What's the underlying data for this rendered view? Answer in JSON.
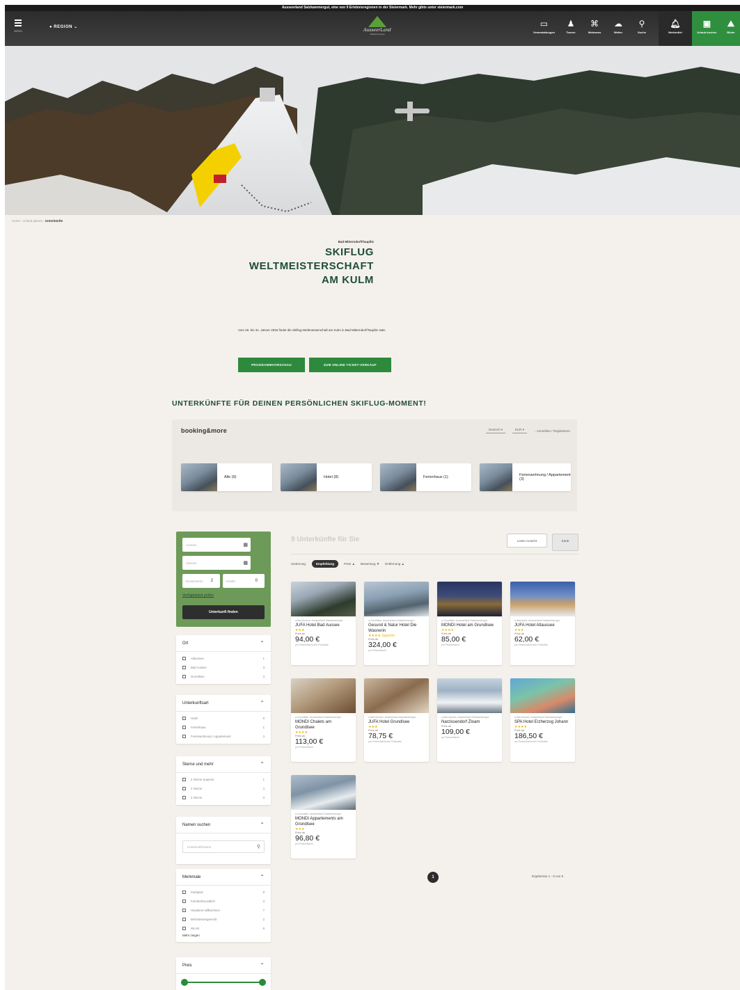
{
  "top_strip": {
    "text": "Ausseerland Salzkammergut, eine von 9 Erlebnisregionen in der Steiermark. Mehr gibts unter steiermark.com"
  },
  "nav": {
    "menu_label": "MENÜ",
    "region_label": "REGION",
    "logo_title": "AusseerLand",
    "logo_sub": "Salzkammergut",
    "items": [
      {
        "label": "Veranstaltungen",
        "icon": "calendar-icon",
        "glyph": "▭"
      },
      {
        "label": "Touren",
        "icon": "hiker-icon",
        "glyph": "♟"
      },
      {
        "label": "Webcams",
        "icon": "webcam-icon",
        "glyph": "⌘"
      },
      {
        "label": "Wetter",
        "icon": "weather-icon",
        "glyph": "☁"
      },
      {
        "label": "Suche",
        "icon": "search-icon",
        "glyph": "⚲"
      }
    ],
    "merkzettel": "Merkzettel",
    "urlaub_buchen": "Urlaub buchen",
    "bilder": "Bilder"
  },
  "breadcrumb": {
    "items": [
      "Home",
      "Urlaub planen"
    ],
    "current": "Unterkünfte"
  },
  "intro": {
    "kicker": "Bad Mitterndorf/Tauplitz",
    "title_lines": [
      "SKIFLUG",
      "WELTMEISTERSCHAFT",
      "AM KULM"
    ],
    "description": "Vom 26. bis 31. Jänner 2026 findet die Skiflug-Weltmeisterschaft am Kulm in Bad Mitterndorf/Tauplitz statt.",
    "btn_program": "PROGRAMMVORSCHAU",
    "btn_tickets": "ZUM ONLINE TICKET-VERKAUF"
  },
  "section_heading": "UNTERKÜNFTE FÜR DEINEN PERSÖNLICHEN SKIFLUG-MOMENT!",
  "booking_widget": {
    "brand": "booking&more",
    "language": "Deutsch",
    "currency": "EUR",
    "login": "Anmelden / Registrieren",
    "category_tabs": [
      {
        "label": "Alle (9)"
      },
      {
        "label": "Hotel (8)"
      },
      {
        "label": "Ferienhaus (1)"
      },
      {
        "label": "Ferienwohnung / Appartement (3)"
      }
    ]
  },
  "search_box": {
    "arrival_placeholder": "Anreise",
    "departure_placeholder": "Abreise",
    "adults_label": "Erwachsene",
    "adults_value": "2",
    "children_label": "Kinder",
    "children_value": "0",
    "availability_link": "Verfügbarkeit prüfen",
    "search_button": "Unterkunft finden"
  },
  "filters": {
    "ort": {
      "title": "Ort",
      "options": [
        {
          "label": "Altaussee",
          "count": "1"
        },
        {
          "label": "Bad Aussee",
          "count": "3"
        },
        {
          "label": "Grundlsee",
          "count": "3"
        }
      ]
    },
    "type": {
      "title": "Unterkunftsart",
      "options": [
        {
          "label": "Hotel",
          "count": "8"
        },
        {
          "label": "Ferienhaus",
          "count": "1"
        },
        {
          "label": "Ferienwohnung / Appartement",
          "count": "3"
        }
      ]
    },
    "stars": {
      "title": "Sterne und mehr",
      "options": [
        {
          "label": "4 Sterne Superior",
          "count": "1"
        },
        {
          "label": "4 Sterne",
          "count": "4"
        },
        {
          "label": "3 Sterne",
          "count": "3"
        }
      ]
    },
    "name": {
      "title": "Namen suchen",
      "placeholder": "Unterkunftsname"
    },
    "features": {
      "title": "Merkmale",
      "options": [
        {
          "label": "Parkplatz",
          "count": "8"
        },
        {
          "label": "Familienfreundlich",
          "count": "3"
        },
        {
          "label": "Haustiere willkommen",
          "count": "7"
        },
        {
          "label": "Behindertengerecht",
          "count": "2"
        },
        {
          "label": "WLAN",
          "count": "8"
        }
      ],
      "more": "Mehr zeigen"
    },
    "price": {
      "title": "Preis"
    }
  },
  "results": {
    "title": "9 Unterkünfte für Sie",
    "list_view": "Listen-Ansicht",
    "map_view": "Karte",
    "sort_label": "Sortierung:",
    "sort_options": [
      "Empfehlung",
      "Preis ▲",
      "Bewertung ▼",
      "Entfernung ▲"
    ],
    "cards": [
      {
        "loc": "Bad Aussee, Ausseerland Salzkammergut",
        "name": "JUFA Hotel Bad Aussee",
        "stars": "★★★",
        "price_label": "Preis ab",
        "price": "94,00 €",
        "price_sub": "pro Person/Nacht inkl. Frühstück"
      },
      {
        "loc": "Grundlsee, Ausseerland Salzkammergut",
        "name": "Gesund & Natur Hotel Die Wasnerin",
        "stars": "★★★★ Superior",
        "price_label": "Preis ab",
        "price": "324,00 €",
        "price_sub": "pro Person/Nacht"
      },
      {
        "loc": "Grundlsee, Ausseerland Salzkammergut",
        "name": "MONDI Hotel am Grundlsee",
        "stars": "★★★★",
        "price_label": "Preis ab",
        "price": "85,00 €",
        "price_sub": "pro Person/Nacht"
      },
      {
        "loc": "Altaussee, Ausseerland Salzkammergut",
        "name": "JUFA Hotel Altaussee",
        "stars": "★★★",
        "price_label": "Preis ab",
        "price": "62,00 €",
        "price_sub": "pro Person/Nacht inkl. Frühstück"
      },
      {
        "loc": "Grundlsee, Ausseerland Salzkammergut",
        "name": "MONDI Chalets am Grundlsee",
        "stars": "★★★★",
        "price_label": "Preis ab",
        "price": "113,00 €",
        "price_sub": "pro Person/Nacht"
      },
      {
        "loc": "Bad Aussee, Ausseerland Salzkammergut",
        "name": "JUFA Hotel Grundlsee",
        "stars": "★★★",
        "price_label": "Preis ab",
        "price": "78,75 €",
        "price_sub": "pro Person/Nacht inkl. Frühstück"
      },
      {
        "loc": "Bad Aussee, Ausseerland Salzkammergut",
        "name": "Narzissendorf Zloam",
        "stars": "",
        "price_label": "Preis ab",
        "price": "109,00 €",
        "price_sub": "pro Person/Nacht"
      },
      {
        "loc": "Bad Aussee, Ausseerland Salzkammergut",
        "name": "SPA Hotel Erzherzog Johann",
        "stars": "★★★★",
        "price_label": "Preis ab",
        "price": "186,50 €",
        "price_sub": "pro Person/Nacht inkl. Frühstück"
      },
      {
        "loc": "Grundlsee, Ausseerland Salzkammergut",
        "name": "MONDI Appartements am Grundlsee",
        "stars": "★★★",
        "price_label": "Preis ab",
        "price": "96,80 €",
        "price_sub": "pro Person/Nacht"
      }
    ],
    "page": "1",
    "page_info": "Ergebnisse 1 - 9 von 9"
  }
}
